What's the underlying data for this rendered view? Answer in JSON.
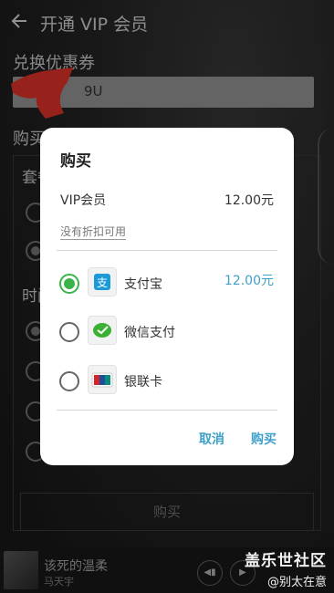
{
  "header": {
    "title": "开通 VIP 会员"
  },
  "coupon": {
    "section_label": "兑换优惠券",
    "value_visible": "9U"
  },
  "background": {
    "buy_section_label": "购买",
    "package_label": "套餐",
    "time_label": "时间",
    "buy_button": "购买"
  },
  "player": {
    "song": "该死的温柔",
    "artist": "马天宇"
  },
  "watermark": {
    "line1": "盖乐世社区",
    "line2": "@别太在意"
  },
  "dialog": {
    "title": "购买",
    "item_name": "VIP会员",
    "item_price": "12.00元",
    "discount_link": "没有折扣可用",
    "payment_methods": [
      {
        "label": "支付宝",
        "price": "12.00元",
        "selected": true,
        "icon": "alipay-icon"
      },
      {
        "label": "微信支付",
        "price": "",
        "selected": false,
        "icon": "wechat-pay-icon"
      },
      {
        "label": "银联卡",
        "price": "",
        "selected": false,
        "icon": "unionpay-icon"
      }
    ],
    "cancel": "取消",
    "confirm": "购买"
  },
  "colors": {
    "accent": "#3ea0c8",
    "selected_radio": "#3cb34a",
    "annotation_red": "#e8352a"
  }
}
